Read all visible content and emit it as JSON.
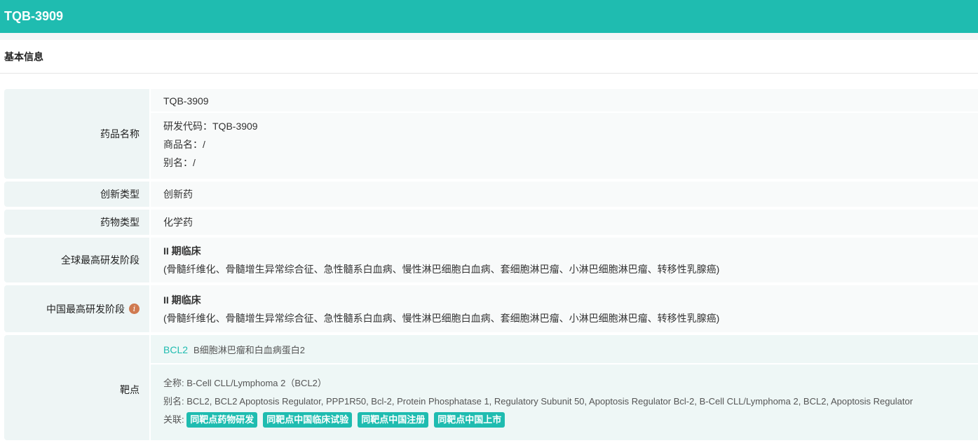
{
  "header": {
    "title": "TQB-3909"
  },
  "section": {
    "title": "基本信息"
  },
  "rows": {
    "name": {
      "label": "药品名称",
      "primary": "TQB-3909",
      "code": "研发代码：TQB-3909",
      "trade": "商品名：/",
      "alias": "别名：/"
    },
    "innovation": {
      "label": "创新类型",
      "value": "创新药"
    },
    "drug_type": {
      "label": "药物类型",
      "value": "化学药"
    },
    "global_stage": {
      "label": "全球最高研发阶段",
      "stage": "II 期临床",
      "indications": "(骨髓纤维化、骨髓增生异常综合征、急性髓系白血病、慢性淋巴细胞白血病、套细胞淋巴瘤、小淋巴细胞淋巴瘤、转移性乳腺癌)"
    },
    "china_stage": {
      "label": "中国最高研发阶段",
      "stage": "II 期临床",
      "indications": "(骨髓纤维化、骨髓增生异常综合征、急性髓系白血病、慢性淋巴细胞白血病、套细胞淋巴瘤、小淋巴细胞淋巴瘤、转移性乳腺癌)"
    },
    "target": {
      "label": "靶点",
      "symbol": "BCL2",
      "name": "B细胞淋巴瘤和白血病蛋白2",
      "full_name_label": "全称:",
      "full_name": "B-Cell CLL/Lymphoma 2（BCL2）",
      "alias_label": "别名:",
      "aliases": "BCL2, BCL2 Apoptosis Regulator, PPP1R50, Bcl-2, Protein Phosphatase 1, Regulatory Subunit 50, Apoptosis Regulator Bcl-2, B-Cell CLL/Lymphoma 2, BCL2, Apoptosis Regulator",
      "related_label": "关联:",
      "tags": [
        "同靶点药物研发",
        "同靶点中国临床试验",
        "同靶点中国注册",
        "同靶点中国上市"
      ]
    }
  }
}
